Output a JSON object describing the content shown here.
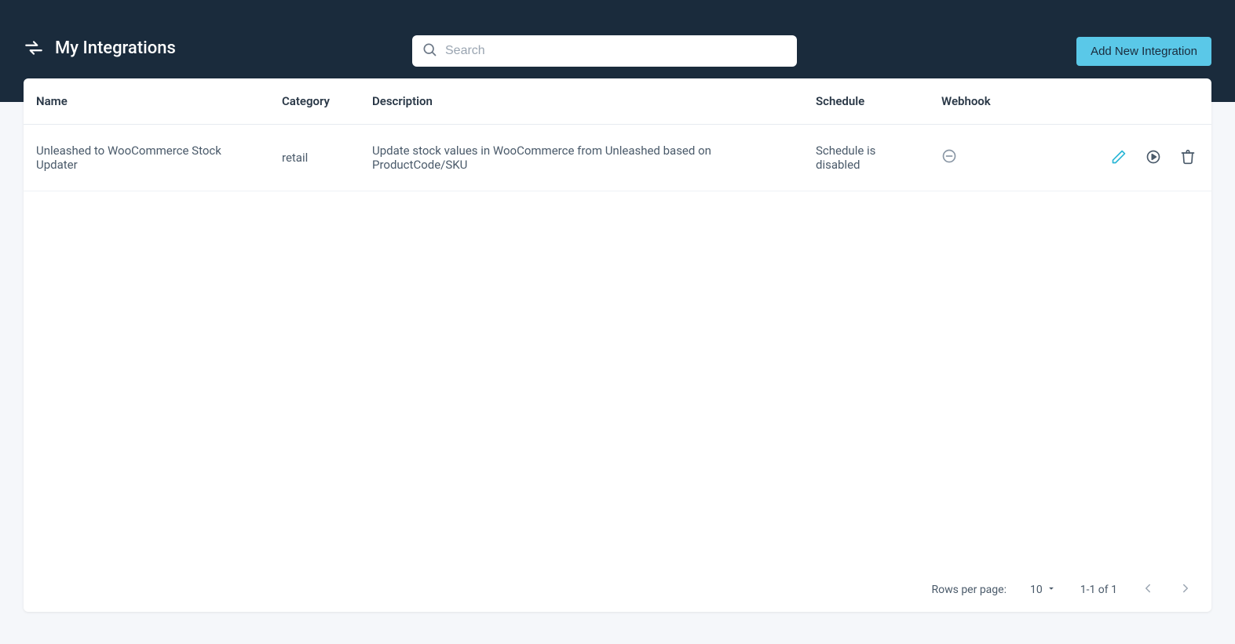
{
  "header": {
    "title": "My Integrations",
    "search_placeholder": "Search",
    "add_button": "Add New Integration"
  },
  "table": {
    "columns": {
      "name": "Name",
      "category": "Category",
      "description": "Description",
      "schedule": "Schedule",
      "webhook": "Webhook"
    },
    "rows": [
      {
        "name": "Unleashed to WooCommerce Stock Updater",
        "category": "retail",
        "description": "Update stock values in WooCommerce from Unleashed based on ProductCode/SKU",
        "schedule": "Schedule is disabled",
        "webhook_state": "disabled"
      }
    ]
  },
  "pagination": {
    "rows_label": "Rows per page:",
    "rows_value": "10",
    "range_label": "1-1 of 1"
  }
}
